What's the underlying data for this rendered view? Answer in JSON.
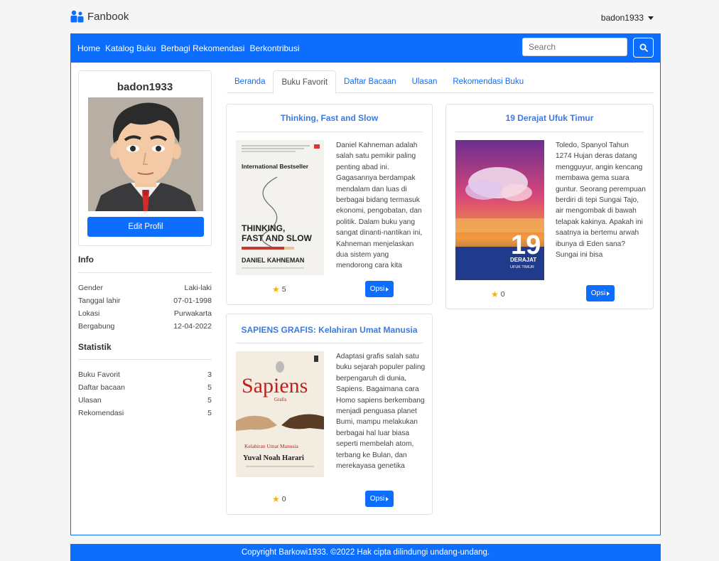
{
  "brand": {
    "name": "Fanbook",
    "icon": "people-icon"
  },
  "user_menu": {
    "username": "badon1933"
  },
  "navbar": {
    "links": [
      "Home",
      "Katalog Buku",
      "Berbagi Rekomendasi",
      "Berkontribusi"
    ],
    "search_placeholder": "Search",
    "search_icon": "search-icon",
    "color": "#0d6efd"
  },
  "profile": {
    "username": "badon1933",
    "edit_label": "Edit Profil",
    "info_title": "Info",
    "info": [
      {
        "label": "Gender",
        "value": "Laki-laki"
      },
      {
        "label": "Tanggal lahir",
        "value": "07-01-1998"
      },
      {
        "label": "Lokasi",
        "value": "Purwakarta"
      },
      {
        "label": "Bergabung",
        "value": "12-04-2022"
      }
    ],
    "stats_title": "Statistik",
    "stats": [
      {
        "label": "Buku Favorit",
        "value": "3"
      },
      {
        "label": "Daftar bacaan",
        "value": "5"
      },
      {
        "label": "Ulasan",
        "value": "5"
      },
      {
        "label": "Rekomendasi",
        "value": "5"
      }
    ]
  },
  "tabs": [
    "Beranda",
    "Buku Favorit",
    "Daftar Bacaan",
    "Ulasan",
    "Rekomendasi Buku"
  ],
  "active_tab": "Buku Favorit",
  "books": [
    {
      "title": "Thinking, Fast and Slow",
      "description": "Daniel Kahneman adalah salah satu pemikir paling penting abad ini. Gagasannya berdampak mendalam dan luas di berbagai bidang termasuk ekonomi, pengobatan, dan politik. Dalam buku yang sangat dinanti-nantikan ini, Kahneman menjelaskan dua sistem yang mendorong cara kita",
      "rating": "5",
      "button": "Opsi",
      "cover": {
        "top_text": "International Bestseller",
        "title_line1": "THINKING,",
        "title_line2": "FAST AND SLOW",
        "author": "DANIEL KAHNEMAN"
      }
    },
    {
      "title": "19 Derajat Ufuk Timur",
      "description": "Toledo, Spanyol Tahun 1274 Hujan deras datang mengguyur, angin kencang membawa gema suara guntur. Seorang perempuan berdiri di tepi Sungai Tajo, air mengombak di bawah telapak kakinya. Apakah ini saatnya ia bertemu arwah ibunya di Eden sana? Sungai ini bisa",
      "rating": "0",
      "button": "Opsi",
      "cover": {
        "number": "19",
        "subtitle": "DERAJAT",
        "subtitle2": "UFUK TIMUR"
      }
    },
    {
      "title": "SAPIENS GRAFIS: Kelahiran Umat Manusia",
      "description": "Adaptasi grafis salah satu buku sejarah populer paling berpengaruh di dunia, Sapiens. Bagaimana cara Homo sapiens berkembang menjadi penguasa planet Bumi, mampu melakukan berbagai hal luar biasa seperti membelah atom, terbang ke Bulan, dan merekayasa genetika",
      "rating": "0",
      "button": "Opsi",
      "cover": {
        "title": "Sapiens",
        "sub": "Grafis",
        "caption": "Kelahiran Umat Manusia",
        "author": "Yuval Noah Harari"
      }
    }
  ],
  "footer": {
    "text": "Copyright Barkowi1933. ©2022 Hak cipta dilindungi undang-undang."
  }
}
